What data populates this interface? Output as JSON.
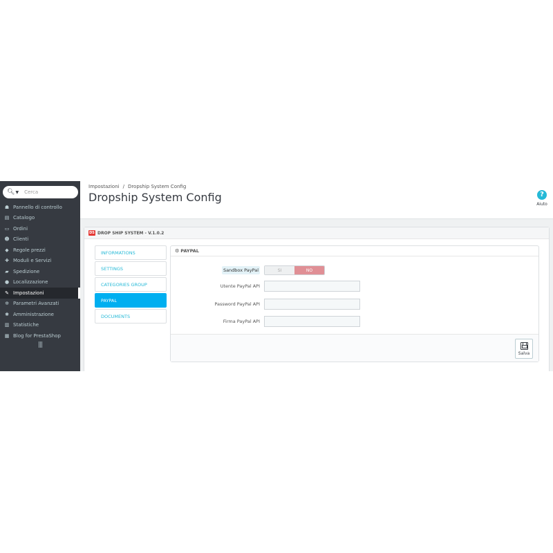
{
  "sidebar": {
    "search_placeholder": "Cerca",
    "items": [
      {
        "icon": "dashboard-icon",
        "glyph": "☗",
        "label": "Pannello di controllo"
      },
      {
        "icon": "catalog-icon",
        "glyph": "▤",
        "label": "Catalogo"
      },
      {
        "icon": "orders-icon",
        "glyph": "▭",
        "label": "Ordini"
      },
      {
        "icon": "customers-icon",
        "glyph": "☻",
        "label": "Clienti"
      },
      {
        "icon": "price-rules-icon",
        "glyph": "◆",
        "label": "Regole prezzi"
      },
      {
        "icon": "modules-icon",
        "glyph": "✚",
        "label": "Moduli e Servizi"
      },
      {
        "icon": "shipping-icon",
        "glyph": "▰",
        "label": "Spedizione"
      },
      {
        "icon": "localization-icon",
        "glyph": "●",
        "label": "Localizzazione"
      },
      {
        "icon": "wrench-icon",
        "glyph": "✎",
        "label": "Impostazioni"
      },
      {
        "icon": "advanced-params-icon",
        "glyph": "✲",
        "label": "Parametri Avanzati"
      },
      {
        "icon": "admin-icon",
        "glyph": "✱",
        "label": "Amministrazione"
      },
      {
        "icon": "stats-icon",
        "glyph": "▥",
        "label": "Statistiche"
      },
      {
        "icon": "blog-icon",
        "glyph": "▦",
        "label": "Blog for PrestaShop"
      }
    ],
    "active_index": 8
  },
  "header": {
    "breadcrumb": [
      "Impostazioni",
      "Dropship System Config"
    ],
    "breadcrumb_sep": "/",
    "title": "Dropship System Config",
    "help_label": "Aiuto"
  },
  "module": {
    "logo_text": "DS",
    "title": "DROP SHIP SYSTEM - V.1.0.2",
    "tabs": [
      "INFORMATIONS",
      "SETTINGS",
      "CATEGORIES GROUP",
      "PAYPAL",
      "DOCUMENTS"
    ],
    "active_tab": 3
  },
  "paypal": {
    "title": "PAYPAL",
    "sandbox_label": "Sandbox PayPal",
    "switch_yes": "SI",
    "switch_no": "NO",
    "user_label": "Utente PayPal API",
    "user_value": "",
    "password_label": "Password PayPal API",
    "password_value": "",
    "signature_label": "Firma PayPal API",
    "signature_value": "",
    "save_label": "Salva"
  },
  "colors": {
    "sidebar_bg": "#363a41",
    "accent": "#25b9d7",
    "active_tab": "#00aff0",
    "switch_no": "#e08f95"
  }
}
